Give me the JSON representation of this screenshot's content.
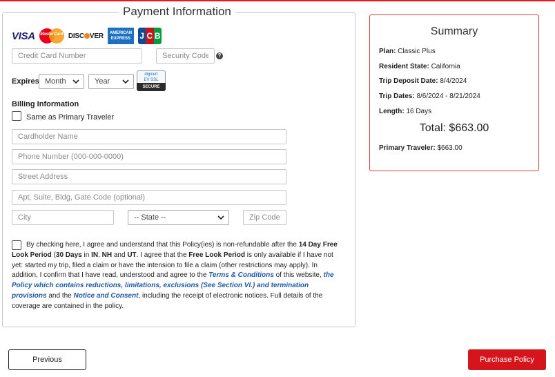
{
  "payment": {
    "legend": "Payment Information",
    "cards": {
      "visa": "VISA",
      "mastercard": "MasterCard",
      "discover_left": "DISC",
      "discover_right": "VER",
      "amex_line1": "AMERICAN",
      "amex_line2": "EXPRESS",
      "jcb": [
        "J",
        "C",
        "B"
      ]
    },
    "card_number_placeholder": "Credit Card Number",
    "security_code_placeholder": "Security Code",
    "help_glyph": "?",
    "expires_label": "Expires",
    "month_value": "Month",
    "year_value": "Year",
    "digicert_line1": "digicert",
    "digicert_line2": "EV SSL",
    "digicert_secure": "SECURE",
    "billing_heading": "Billing Information",
    "same_as_label": "Same as Primary Traveler",
    "cardholder_placeholder": "Cardholder Name",
    "phone_placeholder": "Phone Number (000-000-0000)",
    "street_placeholder": "Street Address",
    "apt_placeholder": "Apt, Suite, Bldg, Gate Code (optional)",
    "city_placeholder": "City",
    "state_value": "-- State --",
    "zip_placeholder": "Zip Code",
    "agreement": {
      "t1": "By checking here, I agree and understand that this Policy(ies) is non-refundable after the ",
      "b1": "14 Day Free Look Period",
      "t2": " (",
      "b2": "30 Days",
      "t3": " in ",
      "b3": "IN",
      "t4": ", ",
      "b4": "NH",
      "t5": " and ",
      "b5": "UT",
      "t6": ". I agree that the ",
      "b6": "Free Look Period",
      "t7": " is only available if I have not yet: started my trip, filed a claim or have the intension to file a claim (other restrictions may apply). In addition, I confirm that I have read, understood and agree to the ",
      "l1": "Terms & Conditions",
      "t8": " of this website, ",
      "l2": "the Policy which contains reductions, limitations, exclusions (See Section VI.) and termination provisions",
      "t9": " and the ",
      "l3": "Notice and Consent",
      "t10": ", including the receipt of electronic notices. Full details of the coverage are contained in the policy."
    }
  },
  "summary": {
    "title": "Summary",
    "rows": [
      {
        "key": "Plan:",
        "value": "Classic Plus"
      },
      {
        "key": "Resident State:",
        "value": "California"
      },
      {
        "key": "Trip Deposit Date:",
        "value": "8/4/2024"
      },
      {
        "key": "Trip Dates:",
        "value": "8/6/2024 - 8/21/2024"
      },
      {
        "key": "Length:",
        "value": "16 Days"
      }
    ],
    "total": "Total: $663.00",
    "traveler_key": "Primary Traveler:",
    "traveler_value": "$663.00"
  },
  "buttons": {
    "previous": "Previous",
    "purchase": "Purchase Policy"
  },
  "colors": {
    "brand_red": "#d6141c",
    "link_blue": "#1d5aa5",
    "summary_border": "#d63a3a"
  }
}
